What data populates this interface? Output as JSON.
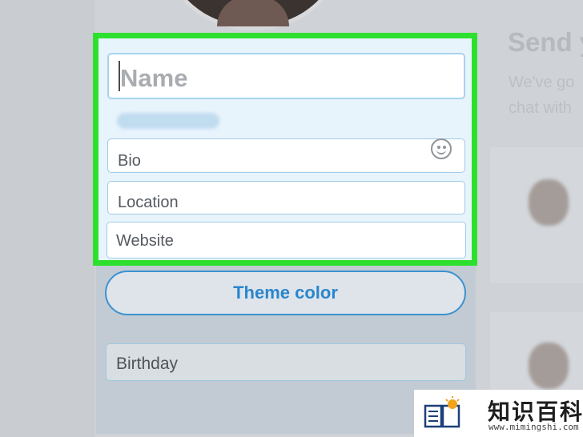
{
  "profile_form": {
    "name_placeholder": "Name",
    "bio_placeholder": "Bio",
    "location_placeholder": "Location",
    "website_placeholder": "Website",
    "theme_color_label": "Theme color",
    "birthday_label": "Birthday"
  },
  "side_panel": {
    "title": "Send y",
    "line1": "We've go",
    "line2": "chat with"
  },
  "watermark": {
    "name": "知识百科",
    "url": "www.mimingshi.com"
  },
  "colors": {
    "highlight_border": "#2ee02e",
    "accent": "#2a86cc"
  },
  "icons": [
    "emoji-icon",
    "brand-book-icon"
  ]
}
